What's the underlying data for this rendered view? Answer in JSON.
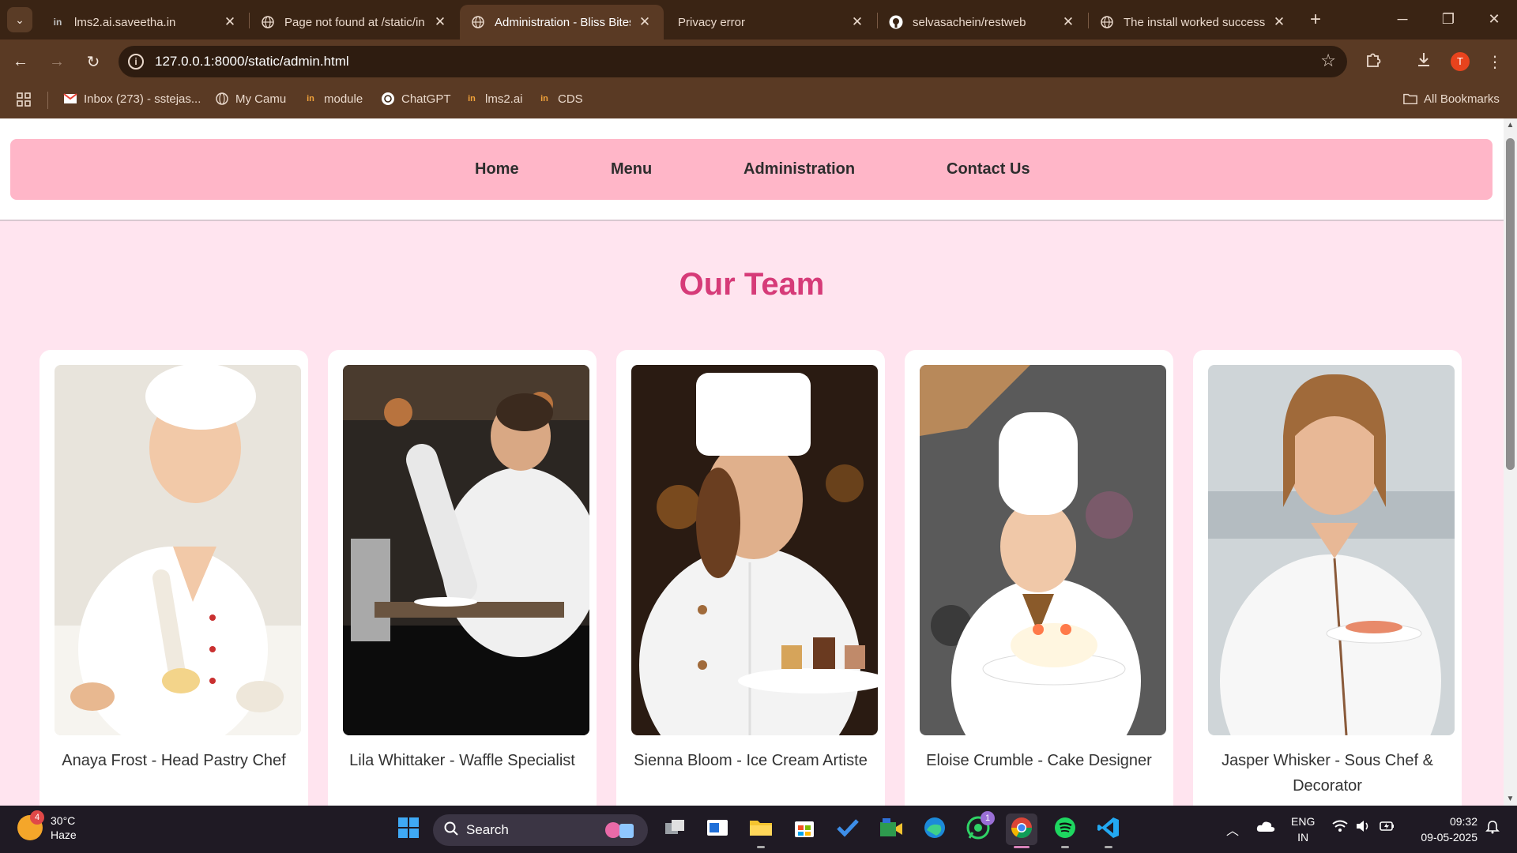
{
  "browser": {
    "tabs": [
      {
        "title": "lms2.ai.saveetha.in",
        "icon": "lms-icon"
      },
      {
        "title": "Page not found at /static/in",
        "icon": "globe-icon"
      },
      {
        "title": "Administration - Bliss Bites",
        "icon": "globe-icon"
      },
      {
        "title": "Privacy error",
        "icon": "none"
      },
      {
        "title": "selvasachein/restweb",
        "icon": "github-icon"
      },
      {
        "title": "The install worked success",
        "icon": "globe-icon"
      }
    ],
    "active_tab_index": 2,
    "url": "127.0.0.1:8000/static/admin.html",
    "profile_initial": "T",
    "bookmarks": [
      {
        "label": "Inbox (273) - sstejas...",
        "icon": "gmail-icon"
      },
      {
        "label": "My Camu",
        "icon": "globe-icon"
      },
      {
        "label": "module",
        "icon": "lms-icon"
      },
      {
        "label": "ChatGPT",
        "icon": "chatgpt-icon"
      },
      {
        "label": "lms2.ai",
        "icon": "lms-icon"
      },
      {
        "label": "CDS",
        "icon": "lms-icon"
      }
    ],
    "all_bookmarks_label": "All Bookmarks"
  },
  "page": {
    "nav": [
      {
        "label": "Home"
      },
      {
        "label": "Menu"
      },
      {
        "label": "Administration"
      },
      {
        "label": "Contact Us"
      }
    ],
    "team_title": "Our Team",
    "team": [
      {
        "name": "Anaya Frost - Head Pastry Chef"
      },
      {
        "name": "Lila Whittaker - Waffle Specialist"
      },
      {
        "name": "Sienna Bloom - Ice Cream Artiste"
      },
      {
        "name": "Eloise Crumble - Cake Designer"
      },
      {
        "name": "Jasper Whisker - Sous Chef & Decorator"
      }
    ],
    "colors": {
      "navbar": "#ffb6c8",
      "title": "#d63b78",
      "page_bg": "#ffe4ef"
    }
  },
  "taskbar": {
    "weather_temp": "30°C",
    "weather_desc": "Haze",
    "weather_badge": "4",
    "search_placeholder": "Search",
    "whatsapp_badge": "1",
    "lang_line1": "ENG",
    "lang_line2": "IN",
    "time": "09:32",
    "date": "09-05-2025"
  }
}
